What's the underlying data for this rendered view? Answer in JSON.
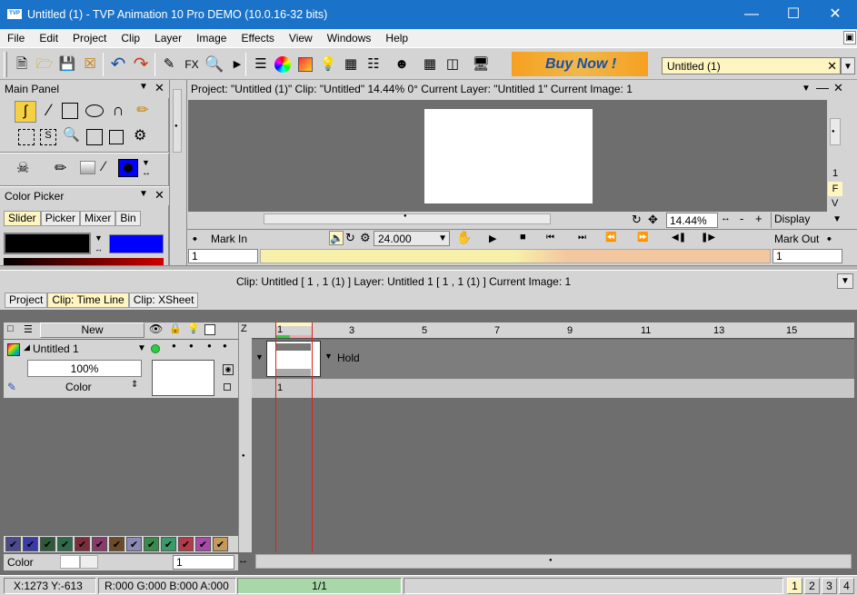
{
  "window": {
    "title": "Untitled (1) - TVP Animation 10 Pro DEMO (10.0.16-32 bits)",
    "logo_text": "TVP"
  },
  "menu": [
    "File",
    "Edit",
    "Project",
    "Clip",
    "Layer",
    "Image",
    "Effects",
    "View",
    "Windows",
    "Help"
  ],
  "toolbar": {
    "fx_label": "FX",
    "buy_now": "Buy Now !",
    "project_select": "Untitled (1)"
  },
  "main_panel": {
    "title": "Main Panel"
  },
  "color_picker": {
    "title": "Color Picker",
    "tabs": [
      "Slider",
      "Picker",
      "Mixer",
      "Bin"
    ],
    "main_color": "#000000",
    "secondary_color": "#0000ff"
  },
  "viewport": {
    "header": "Project:  \"Untitled (1)\"  Clip: \"Untitled\"   14.44%   0°  Current Layer: \"Untitled 1\"  Current Image: 1",
    "zoom": "14.44%",
    "display": "Display",
    "side_labels": [
      "1",
      "F",
      "V"
    ],
    "mark_in": "Mark In",
    "mark_out": "Mark Out",
    "fps": "24.000",
    "mark_in_value": "1",
    "mark_out_value": "1"
  },
  "clip_info": "Clip: Untitled [ 1 , 1  (1) ]     Layer: Untitled 1 [ 1 , 1  (1) ]     Current Image: 1",
  "bottom_tabs": [
    "Project",
    "Clip: Time Line",
    "Clip: XSheet"
  ],
  "timeline": {
    "new_label": "New",
    "z_label": "Z",
    "layer_name": "Untitled 1",
    "opacity": "100%",
    "blend": "Color",
    "hold_label": "Hold",
    "frame_label": "1",
    "ruler": [
      "1",
      "3",
      "5",
      "7",
      "9",
      "11",
      "13",
      "15"
    ],
    "color_mode": "Color",
    "frame_field": "1"
  },
  "status": {
    "coords": "X:1273  Y:-613",
    "rgba": "R:000 G:000 B:000 A:000",
    "frames": "1/1",
    "pages": [
      "1",
      "2",
      "3",
      "4"
    ]
  },
  "swatches": [
    "#4a4a8c",
    "#3a3aa8",
    "#2e5a3a",
    "#2e6a4a",
    "#7a2e3a",
    "#8a3a6a",
    "#6a4a2a",
    "#8a8ab4",
    "#3a8a4a",
    "#3a9a6a",
    "#b43a4a",
    "#a84aa8",
    "#c49a5a"
  ],
  "colors": {
    "accent": "#1a73c9",
    "viewport_bg": "#6e6e6e",
    "timeline_yellow": "#f7f0a8",
    "status_green": "#a8d8a8"
  }
}
